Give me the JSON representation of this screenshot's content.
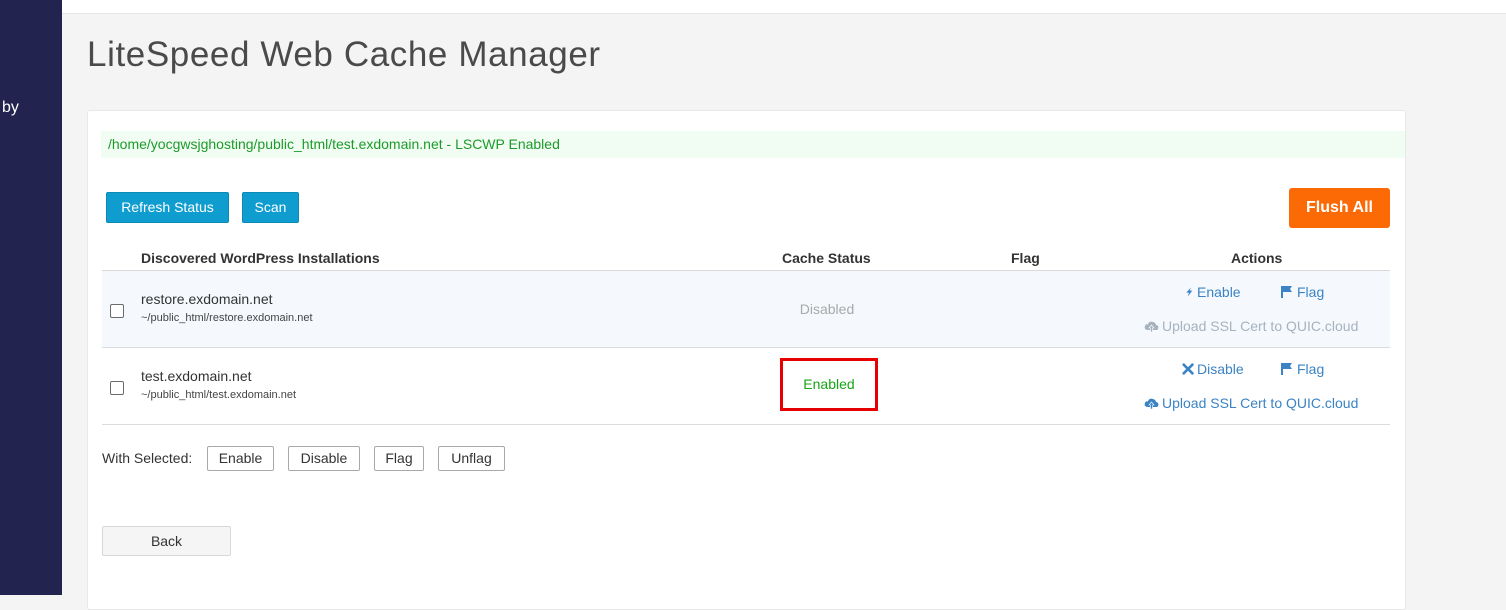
{
  "sidebar": {
    "partial_text": "by"
  },
  "page": {
    "title": "LiteSpeed Web Cache Manager"
  },
  "banner": {
    "path_text": "/home/yocgwsjghosting/public_html/test.exdomain.net - LSCWP Enabled"
  },
  "toolbar": {
    "refresh_label": "Refresh Status",
    "scan_label": "Scan",
    "flush_all_label": "Flush All"
  },
  "table": {
    "headers": {
      "installations": "Discovered WordPress Installations",
      "cache_status": "Cache Status",
      "flag": "Flag",
      "actions": "Actions"
    },
    "rows": [
      {
        "name": "restore.exdomain.net",
        "path": "~/public_html/restore.exdomain.net",
        "status": "Disabled",
        "primary_action": "Enable",
        "flag_action": "Flag",
        "ssl_action": "Upload SSL Cert to QUIC.cloud"
      },
      {
        "name": "test.exdomain.net",
        "path": "~/public_html/test.exdomain.net",
        "status": "Enabled",
        "primary_action": "Disable",
        "flag_action": "Flag",
        "ssl_action": "Upload SSL Cert to QUIC.cloud"
      }
    ]
  },
  "bulk": {
    "label": "With Selected:",
    "enable": "Enable",
    "disable": "Disable",
    "flag": "Flag",
    "unflag": "Unflag"
  },
  "footer": {
    "back_label": "Back"
  },
  "colors": {
    "sidebar": "#22244f",
    "primary_button": "#0f9dcf",
    "flush_button": "#fb6a05",
    "link": "#3b83c4",
    "enabled": "#16a616",
    "highlight_border": "#e60000"
  }
}
